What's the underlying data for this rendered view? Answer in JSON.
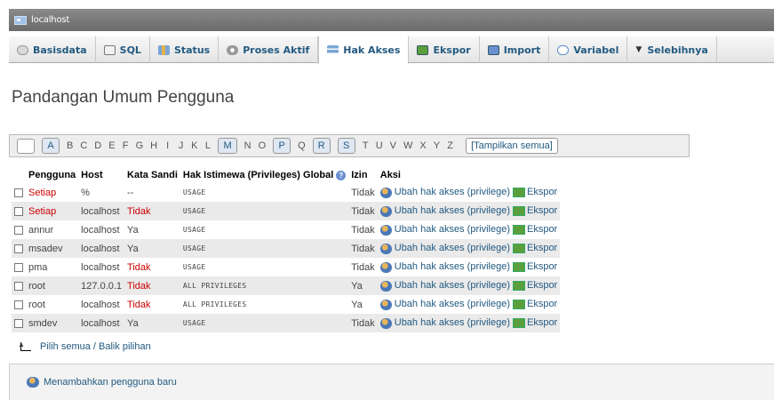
{
  "window": {
    "title": "localhost"
  },
  "tabs": [
    {
      "label": "Basisdata",
      "icon": "database-icon"
    },
    {
      "label": "SQL",
      "icon": "sql-icon"
    },
    {
      "label": "Status",
      "icon": "status-icon"
    },
    {
      "label": "Proses Aktif",
      "icon": "process-icon"
    },
    {
      "label": "Hak Akses",
      "icon": "privileges-icon",
      "active": true
    },
    {
      "label": "Ekspor",
      "icon": "export-icon"
    },
    {
      "label": "Import",
      "icon": "import-icon"
    },
    {
      "label": "Variabel",
      "icon": "variables-icon"
    },
    {
      "label": "Selebihnya",
      "icon": "chevron-down-icon"
    }
  ],
  "page": {
    "title": "Pandangan Umum Pengguna"
  },
  "alphabet": {
    "letters": [
      "A",
      "B",
      "C",
      "D",
      "E",
      "F",
      "G",
      "H",
      "I",
      "J",
      "K",
      "L",
      "M",
      "N",
      "O",
      "P",
      "Q",
      "R",
      "S",
      "T",
      "U",
      "V",
      "W",
      "X",
      "Y",
      "Z"
    ],
    "linked": [
      "A",
      "M",
      "P",
      "R",
      "S"
    ],
    "show_all": "[Tampilkan semua]"
  },
  "table": {
    "headers": {
      "user": "Pengguna",
      "host": "Host",
      "password": "Kata Sandi",
      "privileges": "Hak Istimewa (Privileges) Global",
      "grant": "Izin",
      "action": "Aksi"
    },
    "rows": [
      {
        "user": "Setiap",
        "user_red": true,
        "host": "%",
        "password": "--",
        "password_red": false,
        "privileges": "USAGE",
        "grant": "Tidak",
        "edit": "Ubah hak akses (privilege)",
        "export": "Ekspor"
      },
      {
        "user": "Setiap",
        "user_red": true,
        "host": "localhost",
        "password": "Tidak",
        "password_red": true,
        "privileges": "USAGE",
        "grant": "Tidak",
        "edit": "Ubah hak akses (privilege)",
        "export": "Ekspor"
      },
      {
        "user": "annur",
        "user_red": false,
        "host": "localhost",
        "password": "Ya",
        "password_red": false,
        "privileges": "USAGE",
        "grant": "Tidak",
        "edit": "Ubah hak akses (privilege)",
        "export": "Ekspor"
      },
      {
        "user": "msadev",
        "user_red": false,
        "host": "localhost",
        "password": "Ya",
        "password_red": false,
        "privileges": "USAGE",
        "grant": "Tidak",
        "edit": "Ubah hak akses (privilege)",
        "export": "Ekspor"
      },
      {
        "user": "pma",
        "user_red": false,
        "host": "localhost",
        "password": "Tidak",
        "password_red": true,
        "privileges": "USAGE",
        "grant": "Tidak",
        "edit": "Ubah hak akses (privilege)",
        "export": "Ekspor"
      },
      {
        "user": "root",
        "user_red": false,
        "host": "127.0.0.1",
        "password": "Tidak",
        "password_red": true,
        "privileges": "ALL PRIVILEGES",
        "grant": "Ya",
        "edit": "Ubah hak akses (privilege)",
        "export": "Ekspor"
      },
      {
        "user": "root",
        "user_red": false,
        "host": "localhost",
        "password": "Tidak",
        "password_red": true,
        "privileges": "ALL PRIVILEGES",
        "grant": "Ya",
        "edit": "Ubah hak akses (privilege)",
        "export": "Ekspor"
      },
      {
        "user": "smdev",
        "user_red": false,
        "host": "localhost",
        "password": "Ya",
        "password_red": false,
        "privileges": "USAGE",
        "grant": "Tidak",
        "edit": "Ubah hak akses (privilege)",
        "export": "Ekspor"
      }
    ]
  },
  "selection": {
    "select_all": "Pilih semua",
    "separator": " / ",
    "invert": "Balik pilihan"
  },
  "add_user": {
    "label": "Menambahkan pengguna baru"
  },
  "colors": {
    "link": "#235a81",
    "red": "#cc0000",
    "topbar": "#7a7a7a"
  }
}
